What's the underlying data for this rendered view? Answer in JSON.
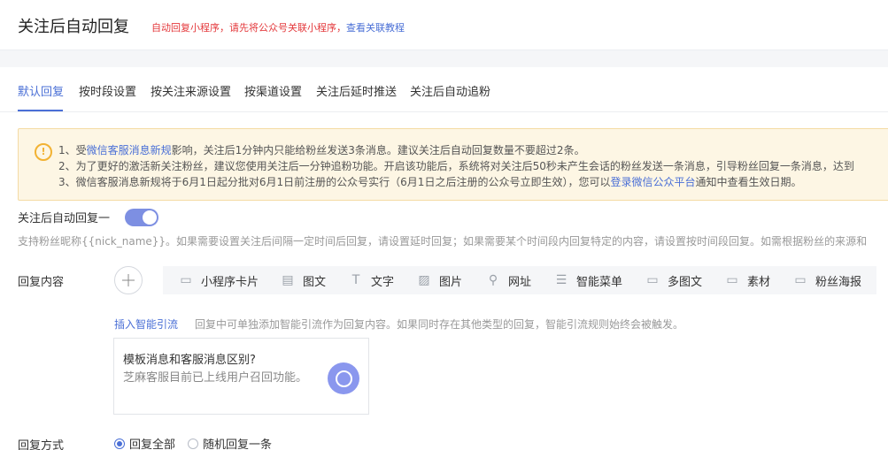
{
  "header": {
    "title": "关注后自动回复",
    "note": "自动回复小程序，请先将公众号关联小程序，",
    "note_link": "查看关联教程"
  },
  "tabs": [
    {
      "label": "默认回复",
      "active": true
    },
    {
      "label": "按时段设置"
    },
    {
      "label": "按关注来源设置"
    },
    {
      "label": "按渠道设置"
    },
    {
      "label": "关注后延时推送"
    },
    {
      "label": "关注后自动追粉"
    }
  ],
  "notice": {
    "line1_a": "1、受",
    "line1_link": "微信客服消息新规",
    "line1_b": "影响，关注后1分钟内只能给粉丝发送3条消息。建议关注后自动回复数量不要超过2条。",
    "line2": "2、为了更好的激活新关注粉丝，建议您使用关注后一分钟追粉功能。开启该功能后，系统将对关注后50秒未产生会话的粉丝发送一条消息，引导粉丝回复一条消息，达到",
    "line3_a": "3、微信客服消息新规将于6月1日起分批对6月1日前注册的公众号实行（6月1日之后注册的公众号立即生效），您可以",
    "line3_link": "登录微信公众平台",
    "line3_b": "通知中查看生效日期。"
  },
  "switch": {
    "label": "关注后自动回复一",
    "on": true
  },
  "hint": "支持粉丝昵称{{nick_name}}。如果需要设置关注后间隔一定时间后回复，请设置延时回复；如果需要某个时间段内回复特定的内容，请设置按时间段回复。如需根据粉丝的来源和",
  "reply_content": {
    "label": "回复内容",
    "types": [
      {
        "label": "小程序卡片",
        "icon": "card-icon"
      },
      {
        "label": "图文",
        "icon": "article-icon"
      },
      {
        "label": "文字",
        "icon": "text-icon"
      },
      {
        "label": "图片",
        "icon": "image-icon"
      },
      {
        "label": "网址",
        "icon": "link-icon"
      },
      {
        "label": "智能菜单",
        "icon": "menu-icon"
      },
      {
        "label": "多图文",
        "icon": "multi-article-icon"
      },
      {
        "label": "素材",
        "icon": "material-icon"
      },
      {
        "label": "粉丝海报",
        "icon": "poster-icon"
      }
    ],
    "smart_flow": "插入智能引流",
    "smart_desc": "回复中可单独添加智能引流作为回复内容。如果同时存在其他类型的回复，智能引流规则始终会被触发。",
    "box_title": "模板消息和客服消息区别?",
    "box_text": "芝麻客服目前已上线用户召回功能。"
  },
  "reply_method": {
    "label": "回复方式",
    "options": [
      {
        "label": "回复全部",
        "checked": true
      },
      {
        "label": "随机回复一条",
        "checked": false
      }
    ]
  }
}
